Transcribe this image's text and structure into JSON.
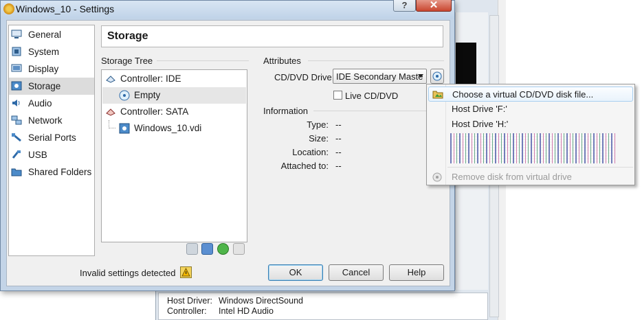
{
  "window": {
    "title": "Windows_10 - Settings",
    "help_label": "?",
    "close_label": "✕"
  },
  "sidebar": {
    "items": [
      {
        "label": "General",
        "icon": "general-icon"
      },
      {
        "label": "System",
        "icon": "system-icon"
      },
      {
        "label": "Display",
        "icon": "display-icon"
      },
      {
        "label": "Storage",
        "icon": "storage-icon",
        "selected": true
      },
      {
        "label": "Audio",
        "icon": "audio-icon"
      },
      {
        "label": "Network",
        "icon": "network-icon"
      },
      {
        "label": "Serial Ports",
        "icon": "serial-ports-icon"
      },
      {
        "label": "USB",
        "icon": "usb-icon"
      },
      {
        "label": "Shared Folders",
        "icon": "shared-folders-icon"
      }
    ]
  },
  "page": {
    "header": "Storage"
  },
  "storage_tree": {
    "label": "Storage Tree",
    "nodes": [
      {
        "label": "Controller: IDE",
        "icon": "ide-controller-icon"
      },
      {
        "label": "Empty",
        "icon": "optical-disc-icon",
        "selected": true
      },
      {
        "label": "Controller: SATA",
        "icon": "sata-controller-icon"
      },
      {
        "label": "Windows_10.vdi",
        "icon": "hard-disk-icon"
      }
    ]
  },
  "attributes": {
    "label": "Attributes",
    "drive_label": "CD/DVD Drive:",
    "drive_value": "IDE Secondary Maste",
    "live_cd_label": "Live CD/DVD"
  },
  "information": {
    "label": "Information",
    "rows": [
      {
        "key": "Type:",
        "value": "--"
      },
      {
        "key": "Size:",
        "value": "--"
      },
      {
        "key": "Location:",
        "value": "--"
      },
      {
        "key": "Attached to:",
        "value": "--"
      }
    ]
  },
  "menu": {
    "items": [
      {
        "label": "Choose a virtual CD/DVD disk file...",
        "highlighted": true
      },
      {
        "label": "Host Drive 'F:'"
      },
      {
        "label": "Host Drive 'H:'"
      },
      {
        "label": "Remove disk from virtual drive",
        "disabled": true
      }
    ]
  },
  "footer": {
    "status": "Invalid settings detected",
    "ok": "OK",
    "cancel": "Cancel",
    "help": "Help"
  },
  "background_panel": {
    "rows": [
      {
        "key": "Host Driver:",
        "value": "Windows DirectSound"
      },
      {
        "key": "Controller:",
        "value": "Intel HD Audio"
      }
    ]
  },
  "colors": {
    "title_bar": "#c0d3e8",
    "close_button": "#c9462f",
    "menu_highlight": "#e9f3fc"
  }
}
